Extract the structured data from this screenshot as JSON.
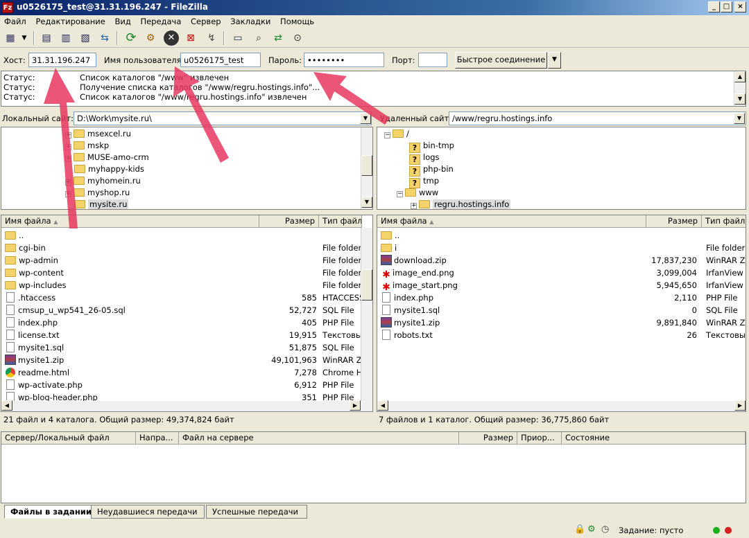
{
  "window": {
    "title": "u0526175_test@31.31.196.247 - FileZilla",
    "app_icon": "Fz"
  },
  "menu": [
    "Файл",
    "Редактирование",
    "Вид",
    "Передача",
    "Сервер",
    "Закладки",
    "Помощь"
  ],
  "quickconnect": {
    "host_label": "Хост:",
    "host_value": "31.31.196.247",
    "user_label": "Имя пользователя:",
    "user_value": "u0526175_test",
    "pass_label": "Пароль:",
    "pass_value": "••••••••",
    "port_label": "Порт:",
    "port_value": "",
    "connect_label": "Быстрое соединение"
  },
  "log": [
    {
      "label": "Статус:",
      "text": "Список каталогов \"/www\" извлечен"
    },
    {
      "label": "Статус:",
      "text": "Получение списка каталогов \"/www/regru.hostings.info\"..."
    },
    {
      "label": "Статус:",
      "text": "Список каталогов \"/www/regru.hostings.info\" извлечен"
    }
  ],
  "local": {
    "site_label": "Локальный сайт:",
    "path": "D:\\Work\\mysite.ru\\",
    "tree": [
      {
        "name": "msexcel.ru",
        "exp": "+"
      },
      {
        "name": "mskp",
        "exp": "+"
      },
      {
        "name": "MUSE-amo-crm",
        "exp": "+"
      },
      {
        "name": "myhappy-kids",
        "exp": ""
      },
      {
        "name": "myhomein.ru",
        "exp": "+"
      },
      {
        "name": "myshop.ru",
        "exp": "+"
      },
      {
        "name": "mysite.ru",
        "exp": ""
      }
    ],
    "columns": {
      "name": "Имя файла",
      "size": "Размер",
      "type": "Тип файла"
    },
    "files": [
      {
        "name": "..",
        "size": "",
        "type": "",
        "icon": "folder"
      },
      {
        "name": "cgi-bin",
        "size": "",
        "type": "File folder",
        "icon": "folder"
      },
      {
        "name": "wp-admin",
        "size": "",
        "type": "File folder",
        "icon": "folder"
      },
      {
        "name": "wp-content",
        "size": "",
        "type": "File folder",
        "icon": "folder"
      },
      {
        "name": "wp-includes",
        "size": "",
        "type": "File folder",
        "icon": "folder"
      },
      {
        "name": ".htaccess",
        "size": "585",
        "type": "HTACCESS",
        "icon": "file"
      },
      {
        "name": "cmsup_u_wp541_26-05.sql",
        "size": "52,727",
        "type": "SQL File",
        "icon": "file"
      },
      {
        "name": "index.php",
        "size": "405",
        "type": "PHP File",
        "icon": "file"
      },
      {
        "name": "license.txt",
        "size": "19,915",
        "type": "Текстовы",
        "icon": "file"
      },
      {
        "name": "mysite1.sql",
        "size": "51,875",
        "type": "SQL File",
        "icon": "file"
      },
      {
        "name": "mysite1.zip",
        "size": "49,101,963",
        "type": "WinRAR ZI",
        "icon": "zip"
      },
      {
        "name": "readme.html",
        "size": "7,278",
        "type": "Chrome HT",
        "icon": "chrome"
      },
      {
        "name": "wp-activate.php",
        "size": "6,912",
        "type": "PHP File",
        "icon": "file"
      },
      {
        "name": "wp-blog-header.php",
        "size": "351",
        "type": "PHP File",
        "icon": "file"
      }
    ],
    "status": "21 файл и 4 каталога. Общий размер: 49,374,824 байт"
  },
  "remote": {
    "site_label": "Удаленный сайт:",
    "path": "/www/regru.hostings.info",
    "tree": [
      {
        "name": "/",
        "kind": "folder"
      },
      {
        "name": "bin-tmp",
        "kind": "q"
      },
      {
        "name": "logs",
        "kind": "q"
      },
      {
        "name": "php-bin",
        "kind": "q"
      },
      {
        "name": "tmp",
        "kind": "q"
      },
      {
        "name": "www",
        "kind": "folder"
      },
      {
        "name": "regru.hostings.info",
        "kind": "folder"
      }
    ],
    "columns": {
      "name": "Имя файла",
      "size": "Размер",
      "type": "Тип файла"
    },
    "files": [
      {
        "name": "..",
        "size": "",
        "type": "",
        "icon": "folder"
      },
      {
        "name": "i",
        "size": "",
        "type": "File folder",
        "icon": "folder"
      },
      {
        "name": "download.zip",
        "size": "17,837,230",
        "type": "WinRAR ZI",
        "icon": "zip"
      },
      {
        "name": "image_end.png",
        "size": "3,099,004",
        "type": "IrfanView P",
        "icon": "img"
      },
      {
        "name": "image_start.png",
        "size": "5,945,650",
        "type": "IrfanView P",
        "icon": "img"
      },
      {
        "name": "index.php",
        "size": "2,110",
        "type": "PHP File",
        "icon": "file"
      },
      {
        "name": "mysite1.sql",
        "size": "0",
        "type": "SQL File",
        "icon": "file"
      },
      {
        "name": "mysite1.zip",
        "size": "9,891,840",
        "type": "WinRAR ZI",
        "icon": "zip"
      },
      {
        "name": "robots.txt",
        "size": "26",
        "type": "Текстовы",
        "icon": "file"
      }
    ],
    "status": "7 файлов и 1 каталог. Общий размер: 36,775,860 байт"
  },
  "queue": {
    "columns": [
      "Сервер/Локальный файл",
      "Напра...",
      "Файл на сервере",
      "Размер",
      "Приор...",
      "Состояние"
    ],
    "tabs": [
      "Файлы в задании",
      "Неудавшиеся передачи",
      "Успешные передачи"
    ]
  },
  "bottom_status": "Задание: пусто",
  "colors": {
    "accent_arrow": "#e8375f",
    "title_start": "#0a246a"
  }
}
